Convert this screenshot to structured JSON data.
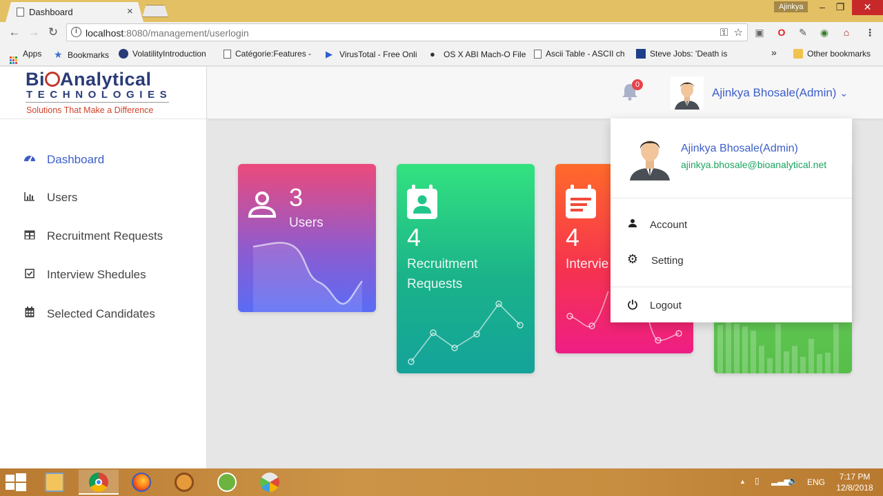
{
  "browser": {
    "tab_title": "Dashboard",
    "tab_close": "×",
    "window_user": "Ajinkya",
    "win_min": "–",
    "win_max": "❐",
    "win_close": "✕",
    "url_host": "localhost",
    "url_path": ":8080/management/userlogin",
    "back": "←",
    "forward": "→",
    "reload": "↻",
    "bookmarks_overflow": "»"
  },
  "bookmarks": [
    {
      "label": "Apps",
      "icon": "apps-grid-icon"
    },
    {
      "label": "Bookmarks",
      "icon": "star-icon"
    },
    {
      "label": "VolatilityIntroduction",
      "icon": "github-icon"
    },
    {
      "label": "Catégorie:Features - ",
      "icon": "document-icon"
    },
    {
      "label": "VirusTotal - Free Onli",
      "icon": "virustotal-icon"
    },
    {
      "label": "OS X ABI Mach-O File",
      "icon": "apple-icon"
    },
    {
      "label": "Ascii Table - ASCII ch",
      "icon": "document-icon"
    },
    {
      "label": "Steve Jobs: 'Death is ",
      "icon": "bookmark-icon"
    },
    {
      "label": "Other bookmarks",
      "icon": "folder-icon"
    }
  ],
  "logo": {
    "top_pre": "Bi",
    "top_post": "Analytical",
    "middle": "TECHNOLOGIES",
    "tagline": "Solutions That Make a Difference"
  },
  "sidebar": {
    "items": [
      {
        "label": "Dashboard",
        "icon": "dashboard-gauge-icon",
        "active": true
      },
      {
        "label": "Users",
        "icon": "bar-chart-icon"
      },
      {
        "label": "Recruitment Requests",
        "icon": "table-icon"
      },
      {
        "label": "Interview Shedules",
        "icon": "checkbox-icon"
      },
      {
        "label": "Selected Candidates",
        "icon": "calendar-icon"
      }
    ]
  },
  "header": {
    "notification_count": "0",
    "user_name": "Ajinkya Bhosale(Admin)",
    "caret": "⌄"
  },
  "cards": [
    {
      "value": "3",
      "label": "Users",
      "color": "#ec4a7b"
    },
    {
      "value": "4",
      "label_line1": "Recruitment",
      "label_line2": "Requests",
      "color": "#1ab28a"
    },
    {
      "value": "4",
      "label": "Intervie",
      "color": "#f6334f"
    },
    {
      "color": "#56be49"
    }
  ],
  "dropdown": {
    "name": "Ajinkya Bhosale(Admin)",
    "email": "ajinkya.bhosale@bioanalytical.net",
    "items": [
      {
        "label": "Account",
        "icon": "person-icon"
      },
      {
        "label": "Setting",
        "icon": "gear-icon"
      },
      {
        "label": "Logout",
        "icon": "power-icon"
      }
    ]
  },
  "taskbar": {
    "apps": [
      "file-explorer-icon",
      "chrome-icon",
      "firefox-icon",
      "monkey-app-icon",
      "spring-leaf-icon",
      "paint-icon"
    ],
    "language": "ENG",
    "time": "7:17 PM",
    "date": "12/8/2018",
    "tray_up": "▲"
  },
  "colors": {
    "accent_blue": "#3d5ec9",
    "email_green": "#1aa35f",
    "badge_red": "#e8434c"
  }
}
